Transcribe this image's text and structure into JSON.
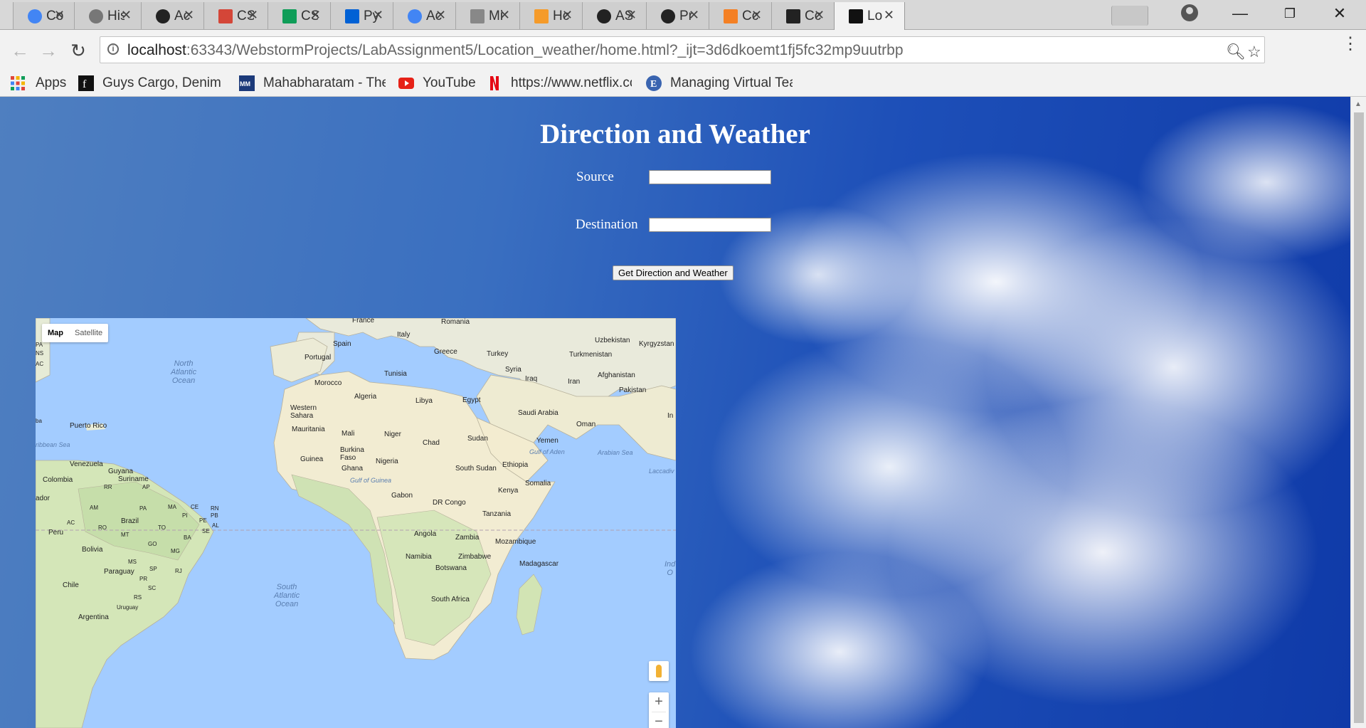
{
  "browser": {
    "tabs": [
      {
        "title": "Co",
        "icon": "chrome-icon"
      },
      {
        "title": "His",
        "icon": "history-icon"
      },
      {
        "title": "Ac",
        "icon": "github-icon"
      },
      {
        "title": "CS",
        "icon": "gmail-icon"
      },
      {
        "title": "CS",
        "icon": "sheets-icon"
      },
      {
        "title": "Py",
        "icon": "box-icon"
      },
      {
        "title": "Ac",
        "icon": "chrome-icon"
      },
      {
        "title": "Mi",
        "icon": "document-icon"
      },
      {
        "title": "Hc",
        "icon": "sun-icon"
      },
      {
        "title": "AS",
        "icon": "github-icon"
      },
      {
        "title": "Pr",
        "icon": "github-icon"
      },
      {
        "title": "Cc",
        "icon": "stackoverflow-icon"
      },
      {
        "title": "Cc",
        "icon": "pycharm-icon"
      },
      {
        "title": "Lo",
        "icon": "webstorm-icon"
      }
    ],
    "address": {
      "host": "localhost",
      "rest": ":63343/WebstormProjects/LabAssignment5/Location_weather/home.html?_ijt=3d6dkoemt1fj5fc32mp9uutrbp"
    },
    "bookmarks": [
      {
        "label": "Apps",
        "icon": "apps-grid-icon"
      },
      {
        "label": "Guys Cargo, Denim &",
        "icon": "guys-cargo-icon"
      },
      {
        "label": "Mahabharatam - The",
        "icon": "mahabharatam-icon"
      },
      {
        "label": "YouTube",
        "icon": "youtube-icon"
      },
      {
        "label": "https://www.netflix.cc",
        "icon": "netflix-icon"
      },
      {
        "label": "Managing Virtual Tea",
        "icon": "edge-e-icon"
      }
    ]
  },
  "page": {
    "title": "Direction and Weather",
    "source_label": "Source",
    "destination_label": "Destination",
    "button_label": "Get Direction and Weather",
    "source_value": "",
    "destination_value": ""
  },
  "map": {
    "type_control": {
      "map": "Map",
      "satellite": "Satellite"
    },
    "zoom_in": "+",
    "zoom_out": "−",
    "labels": {
      "france": "France",
      "romania": "Romania",
      "italy": "Italy",
      "spain": "Spain",
      "portugal": "Portugal",
      "greece": "Greece",
      "turkey": "Turkey",
      "uzbekistan": "Uzbekistan",
      "kyrgyzstan": "Kyrgyzstan",
      "turkmenistan": "Turkmenistan",
      "syria": "Syria",
      "afghanistan": "Afghanistan",
      "tunisia": "Tunisia",
      "iraq": "Iraq",
      "iran": "Iran",
      "pakistan": "Pakistan",
      "morocco": "Morocco",
      "algeria": "Algeria",
      "libya": "Libya",
      "egypt": "Egypt",
      "western_sahara": "Western\nSahara",
      "saudi_arabia": "Saudi Arabia",
      "oman": "Oman",
      "in": "In",
      "mauritania": "Mauritania",
      "mali": "Mali",
      "niger": "Niger",
      "chad": "Chad",
      "sudan": "Sudan",
      "yemen": "Yemen",
      "gulf_of_aden": "Gulf of Aden",
      "arabian_sea": "Arabian Sea",
      "burkina_faso": "Burkina\nFaso",
      "guinea": "Guinea",
      "nigeria": "Nigeria",
      "ghana": "Ghana",
      "south_sudan": "South Sudan",
      "ethiopia": "Ethiopia",
      "laccadive": "Laccadiv",
      "gulf_of_guinea": "Gulf of Guinea",
      "somalia": "Somalia",
      "kenya": "Kenya",
      "gabon": "Gabon",
      "dr_congo": "DR Congo",
      "tanzania": "Tanzania",
      "angola": "Angola",
      "zambia": "Zambia",
      "mozambique": "Mozambique",
      "madagascar": "Madagascar",
      "namibia": "Namibia",
      "zimbabwe": "Zimbabwe",
      "botswana": "Botswana",
      "south_africa": "South Africa",
      "indian_ocean": "Ind\nO",
      "north_atlantic": "North\nAtlantic\nOcean",
      "south_atlantic": "South\nAtlantic\nOcean",
      "puerto_rico": "Puerto Rico",
      "caribbean_sea": "ribbean Sea",
      "venezuela": "Venezuela",
      "guyana": "Guyana",
      "suriname": "Suriname",
      "colombia": "Colombia",
      "ecuador": "ador",
      "rr": "RR",
      "ap": "AP",
      "am": "AM",
      "pa": "PA",
      "ma": "MA",
      "ce": "CE",
      "rn": "RN",
      "pb": "PB",
      "pi": "PI",
      "pe": "PE",
      "al": "AL",
      "se": "SE",
      "ac": "AC",
      "ro": "RO",
      "to": "TO",
      "ba": "BA",
      "mt": "MT",
      "go": "GO",
      "mg": "MG",
      "ms": "MS",
      "sp": "SP",
      "rj": "RJ",
      "pr": "PR",
      "sc": "SC",
      "rs": "RS",
      "peru": "Peru",
      "brazil": "Brazil",
      "bolivia": "Bolivia",
      "paraguay": "Paraguay",
      "chile": "Chile",
      "uruguay": "Uruguay",
      "argentina": "Argentina",
      "pa_left": "PA",
      "ns": "NS",
      "ac_left": "AC",
      "ba_left": "ba"
    }
  }
}
